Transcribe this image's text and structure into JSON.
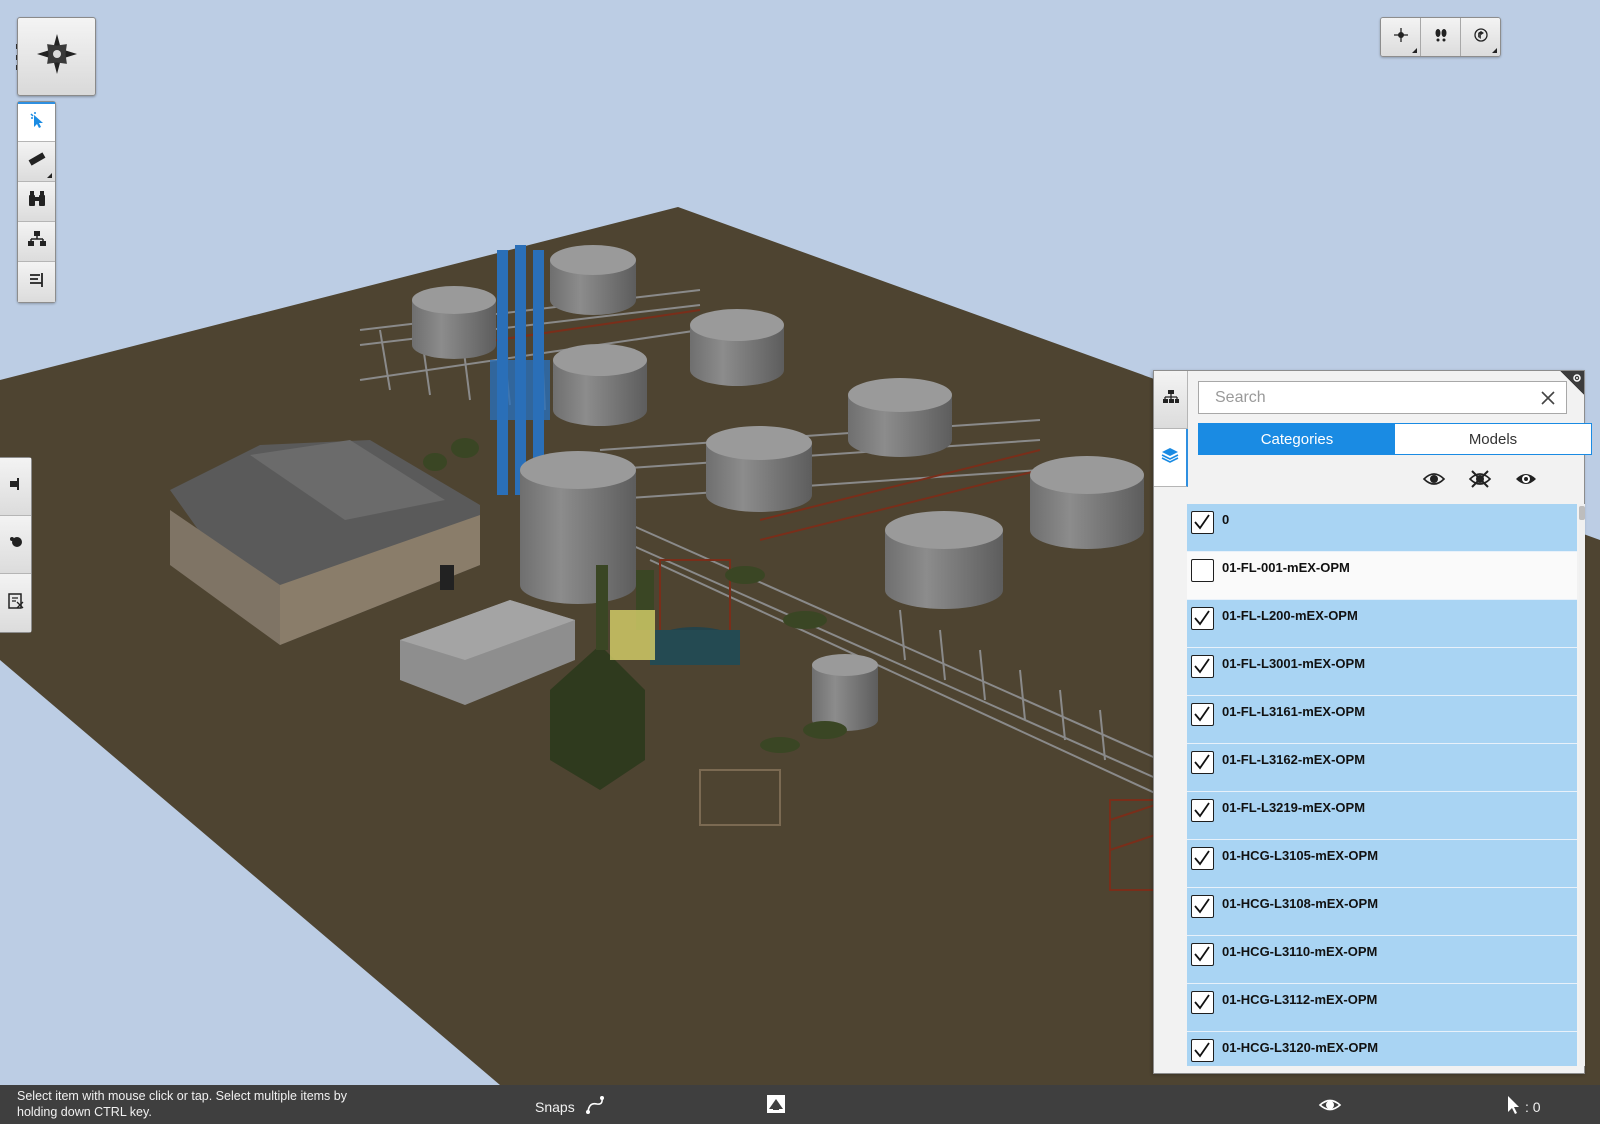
{
  "tools": {
    "left_toolbar": [
      "select-icon",
      "measure-icon",
      "binoculars-icon",
      "hierarchy-icon",
      "properties-icon"
    ],
    "side_panel": [
      "section-icon",
      "appearance-icon",
      "report-icon"
    ],
    "nav": [
      "pan-icon",
      "walk-icon",
      "orbit-icon"
    ]
  },
  "panel": {
    "search_placeholder": "Search",
    "tabs": {
      "categories": "Categories",
      "models": "Models"
    },
    "items": [
      {
        "label": "0",
        "checked": true
      },
      {
        "label": "01-FL-001-mEX-OPM",
        "checked": false
      },
      {
        "label": "01-FL-L200-mEX-OPM",
        "checked": true
      },
      {
        "label": "01-FL-L3001-mEX-OPM",
        "checked": true
      },
      {
        "label": "01-FL-L3161-mEX-OPM",
        "checked": true
      },
      {
        "label": "01-FL-L3162-mEX-OPM",
        "checked": true
      },
      {
        "label": "01-FL-L3219-mEX-OPM",
        "checked": true
      },
      {
        "label": "01-HCG-L3105-mEX-OPM",
        "checked": true
      },
      {
        "label": "01-HCG-L3108-mEX-OPM",
        "checked": true
      },
      {
        "label": "01-HCG-L3110-mEX-OPM",
        "checked": true
      },
      {
        "label": "01-HCG-L3112-mEX-OPM",
        "checked": true
      },
      {
        "label": "01-HCG-L3120-mEX-OPM",
        "checked": true
      }
    ]
  },
  "status": {
    "message": "Select item with mouse click or tap. Select multiple items by holding down CTRL key.",
    "snaps_label": "Snaps",
    "selection_count": ": 0"
  },
  "colors": {
    "sky": "#bccde4",
    "ground": "#4e4431",
    "accent": "#1a8be3",
    "row_selected": "#a9d4f3",
    "statusbar": "#3f3f3f"
  }
}
